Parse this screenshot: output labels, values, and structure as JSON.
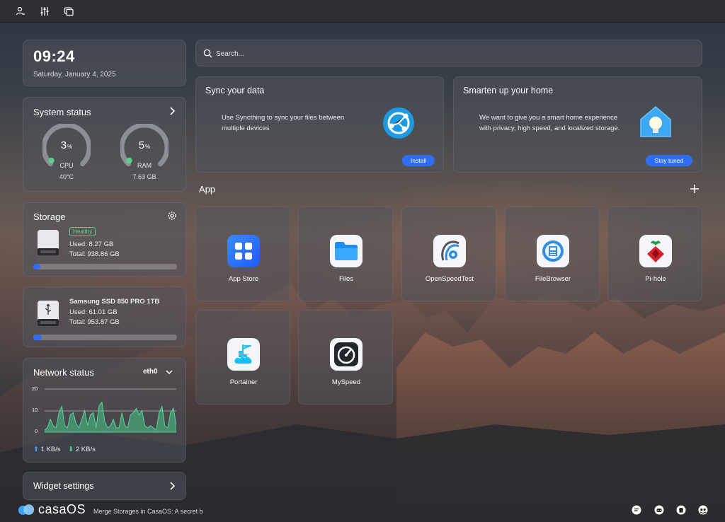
{
  "topbar": {
    "icons": [
      "user-settings-icon",
      "sliders-icon",
      "wallpaper-icon"
    ]
  },
  "clock": {
    "time": "09:24",
    "date": "Saturday, January 4, 2025"
  },
  "system_status": {
    "title": "System status",
    "cpu": {
      "value": "3",
      "unit": "%",
      "label": "CPU",
      "sub": "40°C",
      "percent": 3
    },
    "ram": {
      "value": "5",
      "unit": "%",
      "label": "RAM",
      "sub": "7.63 GB",
      "percent": 5
    }
  },
  "storage": {
    "title": "Storage",
    "badge": "Healthy",
    "used": "Used: 8.27 GB",
    "total": "Total: 938.86 GB",
    "used_fraction": 0.01
  },
  "disk": {
    "name": "Samsung SSD 850 PRO 1TB",
    "used": "Used: 61.01 GB",
    "total": "Total: 953.87 GB",
    "used_fraction": 0.06
  },
  "network": {
    "title": "Network status",
    "interface": "eth0",
    "y_ticks": [
      "20",
      "10",
      "0"
    ],
    "up": "1 KB/s",
    "down": "2 KB/s",
    "chart_values": [
      1,
      2,
      6,
      3,
      2,
      9,
      12,
      3,
      2,
      8,
      9,
      4,
      2,
      6,
      10,
      3,
      8,
      9,
      2,
      12,
      14,
      5,
      2,
      3,
      6,
      2,
      2,
      9,
      3,
      2,
      8,
      9,
      11,
      8,
      10,
      3,
      2,
      3,
      2,
      1,
      9,
      12,
      3,
      2,
      9,
      11,
      3
    ]
  },
  "widget_settings": {
    "label": "Widget settings"
  },
  "search": {
    "placeholder": "Search..."
  },
  "promos": [
    {
      "title": "Sync your data",
      "desc_line1": "Use Syncthing to sync your files between",
      "desc_line2": "multiple devices",
      "button": "Install"
    },
    {
      "title": "Smarten up your home",
      "desc_line1": "We want to give you a smart home experience",
      "desc_line2": "with privacy, high speed, and localized storage.",
      "button": "Stay tuned"
    }
  ],
  "apps_section": {
    "title": "App"
  },
  "apps": [
    {
      "label": "App Store"
    },
    {
      "label": "Files"
    },
    {
      "label": "OpenSpeedTest"
    },
    {
      "label": "FileBrowser"
    },
    {
      "label": "Pi-hole"
    },
    {
      "label": "Portainer"
    },
    {
      "label": "MySpeed"
    }
  ],
  "footer": {
    "brand": "casaOS",
    "news": "Merge Storages in CasaOS: A secret b",
    "icons": [
      "feedback-icon",
      "discord-icon",
      "github-icon",
      "community-icon"
    ]
  },
  "colors": {
    "accent": "#2f6df6",
    "healthy": "#57d18a",
    "gauge_track": "#8c8f95",
    "gauge_fill": "#57d18a"
  }
}
